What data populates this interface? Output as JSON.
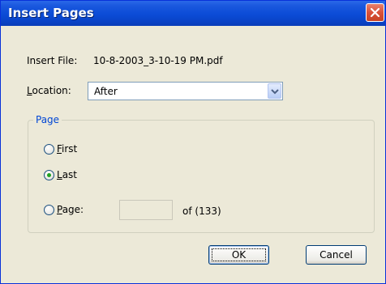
{
  "window": {
    "title": "Insert Pages"
  },
  "insert_file": {
    "label": "Insert File:",
    "value": "10-8-2003_3-10-19 PM.pdf"
  },
  "location": {
    "label": "Location:",
    "mnemonic": "L",
    "label_rest": "ocation:",
    "selected": "After"
  },
  "page_group": {
    "title": "Page",
    "options": [
      {
        "mnemonic": "F",
        "rest": "irst",
        "checked": false
      },
      {
        "mnemonic": "L",
        "rest": "ast",
        "checked": true
      },
      {
        "mnemonic": "P",
        "rest": "age:",
        "checked": false
      }
    ],
    "page_input_value": "",
    "of_text": "of (133)"
  },
  "buttons": {
    "ok": "OK",
    "cancel": "Cancel"
  },
  "colors": {
    "title_bar": "#0b4bd6",
    "dialog_bg": "#ece9d8",
    "group_title": "#0046d5",
    "radio_dot": "#21a121"
  }
}
